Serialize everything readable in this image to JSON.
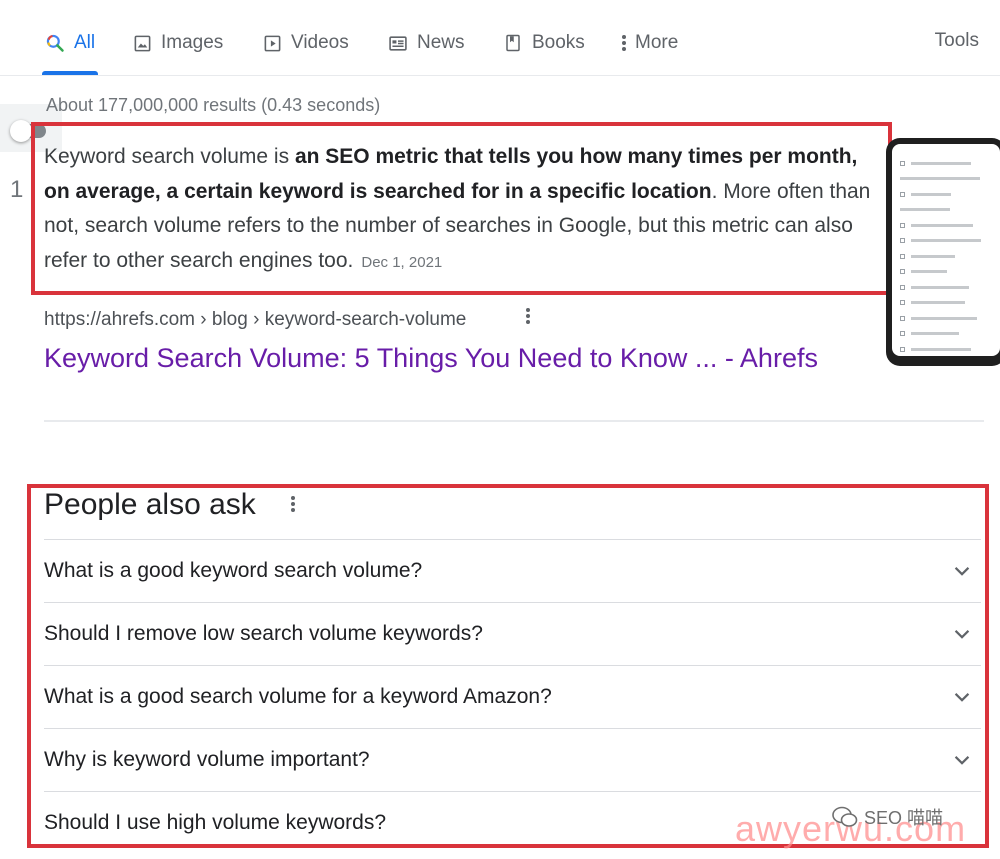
{
  "tabs": [
    {
      "label": "All",
      "icon": "search-icon",
      "active": true
    },
    {
      "label": "Images",
      "icon": "image-icon"
    },
    {
      "label": "Videos",
      "icon": "play-icon"
    },
    {
      "label": "News",
      "icon": "news-icon"
    },
    {
      "label": "Books",
      "icon": "book-icon"
    },
    {
      "label": "More",
      "icon": "more-vert-icon"
    }
  ],
  "tools_label": "Tools",
  "result_stats": "About 177,000,000 results (0.43 seconds)",
  "page_number": "1",
  "snippet": {
    "intro": "Keyword search volume is ",
    "bold": "an SEO metric that tells you how many times per month, on average, a certain keyword is searched for in a specific location",
    "rest": ". More often than not, search volume refers to the number of searches in Google, but this metric can also refer to other search engines too.",
    "date": "Dec 1, 2021"
  },
  "result": {
    "cite": "https://ahrefs.com › blog › keyword-search-volume",
    "title": "Keyword Search Volume: 5 Things You Need to Know ... - Ahrefs"
  },
  "people_also_ask": {
    "title": "People also ask",
    "questions": [
      "What is a good keyword search volume?",
      "Should I remove low search volume keywords?",
      "What is a good search volume for a keyword Amazon?",
      "Why is keyword volume important?",
      "Should I use high volume keywords?"
    ]
  },
  "watermark": {
    "brand": "SEO 喵喵",
    "text": "awyerwu.com"
  },
  "colors": {
    "accent": "#1a73e8",
    "visited_link": "#681da8",
    "highlight_box": "#d9333b"
  }
}
